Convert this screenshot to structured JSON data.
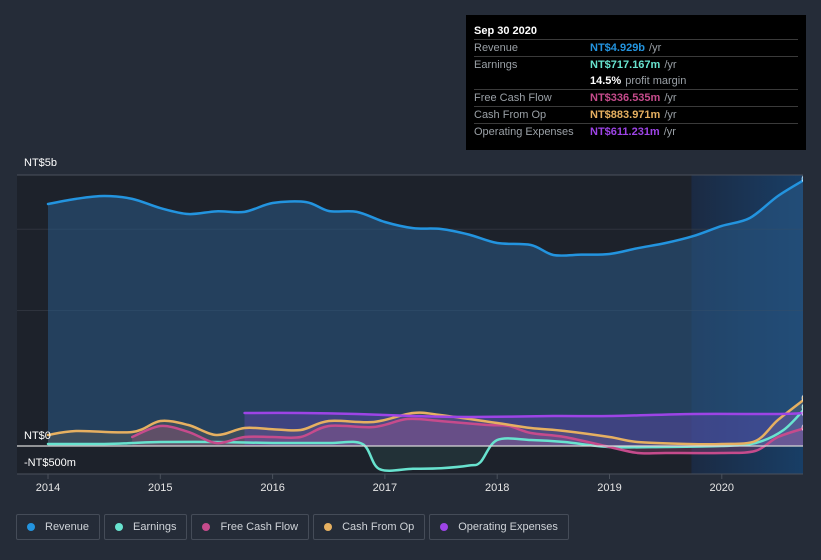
{
  "tooltip": {
    "date": "Sep 30 2020",
    "rows": [
      {
        "label": "Revenue",
        "value": "NT$4.929b",
        "unit": "/yr",
        "color": "#2394df"
      },
      {
        "label": "Earnings",
        "value": "NT$717.167m",
        "unit": "/yr",
        "color": "#68e3cf"
      },
      {
        "label": "",
        "margin_value": "14.5%",
        "margin_text": "profit margin"
      },
      {
        "label": "Free Cash Flow",
        "value": "NT$336.535m",
        "unit": "/yr",
        "color": "#c64b8c"
      },
      {
        "label": "Cash From Op",
        "value": "NT$883.971m",
        "unit": "/yr",
        "color": "#e6b061"
      },
      {
        "label": "Operating Expenses",
        "value": "NT$611.231m",
        "unit": "/yr",
        "color": "#9d44e6"
      }
    ]
  },
  "legend": [
    {
      "label": "Revenue",
      "color": "#2394df"
    },
    {
      "label": "Earnings",
      "color": "#68e3cf"
    },
    {
      "label": "Free Cash Flow",
      "color": "#c64b8c"
    },
    {
      "label": "Cash From Op",
      "color": "#e6b061"
    },
    {
      "label": "Operating Expenses",
      "color": "#9d44e6"
    }
  ],
  "chart_data": {
    "type": "line",
    "title": "",
    "xlabel": "",
    "ylabel": "",
    "currency": "NT$",
    "y_unit": "millions",
    "ylim": [
      -500,
      5000
    ],
    "xlim": [
      2013.7,
      2020.75
    ],
    "y_tick_labels": [
      {
        "value": 5000,
        "label": "NT$5b"
      },
      {
        "value": 0,
        "label": "NT$0"
      },
      {
        "value": -500,
        "label": "-NT$500m"
      }
    ],
    "x_tick_labels": [
      "2014",
      "2015",
      "2016",
      "2017",
      "2018",
      "2019",
      "2020"
    ],
    "x_ticks": [
      2014,
      2015,
      2016,
      2017,
      2018,
      2019,
      2020
    ],
    "highlight_from": 2019.73,
    "grid": true,
    "legend_position": "bottom",
    "series": [
      {
        "name": "Revenue",
        "color": "#2394df",
        "fill": true,
        "x": [
          2014,
          2014.25,
          2014.5,
          2014.75,
          2015,
          2015.25,
          2015.5,
          2015.75,
          2016,
          2016.3,
          2016.5,
          2016.75,
          2017,
          2017.25,
          2017.5,
          2017.75,
          2018,
          2018.3,
          2018.5,
          2018.75,
          2019,
          2019.25,
          2019.5,
          2019.75,
          2020,
          2020.25,
          2020.5,
          2020.75
        ],
        "values": [
          4465,
          4560,
          4612,
          4560,
          4390,
          4280,
          4330,
          4320,
          4483,
          4500,
          4336,
          4320,
          4133,
          4020,
          4004,
          3900,
          3745,
          3708,
          3524,
          3530,
          3542,
          3650,
          3745,
          3875,
          4060,
          4207,
          4612,
          4929
        ]
      },
      {
        "name": "Earnings",
        "color": "#68e3cf",
        "fill": true,
        "x": [
          2014,
          2014.5,
          2014.75,
          2015,
          2015.5,
          2016,
          2016.5,
          2016.8,
          2016.95,
          2017.25,
          2017.5,
          2017.75,
          2017.85,
          2018,
          2018.3,
          2018.6,
          2019,
          2019.5,
          2020,
          2020.3,
          2020.55,
          2020.75
        ],
        "values": [
          37,
          37,
          55,
          74,
          74,
          55,
          55,
          37,
          -424,
          -420,
          -410,
          -360,
          -300,
          111,
          111,
          74,
          -18,
          -18,
          0,
          55,
          295,
          717
        ]
      },
      {
        "name": "Free Cash Flow",
        "color": "#c64b8c",
        "fill": true,
        "x": [
          2014.75,
          2015,
          2015.25,
          2015.5,
          2015.75,
          2016,
          2016.25,
          2016.5,
          2016.9,
          2017.2,
          2017.5,
          2017.9,
          2018.1,
          2018.3,
          2018.6,
          2019,
          2019.25,
          2019.5,
          2020,
          2020.3,
          2020.5,
          2020.75
        ],
        "values": [
          166,
          369,
          260,
          55,
          166,
          166,
          166,
          369,
          350,
          498,
          460,
          390,
          370,
          240,
          166,
          -18,
          -129,
          -129,
          -129,
          -90,
          166,
          337
        ]
      },
      {
        "name": "Cash From Op",
        "color": "#e6b061",
        "fill": true,
        "x": [
          2014,
          2014.25,
          2014.75,
          2015,
          2015.25,
          2015.5,
          2015.75,
          2016,
          2016.25,
          2016.5,
          2016.9,
          2017.25,
          2017.5,
          2018,
          2018.3,
          2018.6,
          2019,
          2019.25,
          2019.7,
          2020,
          2020.3,
          2020.5,
          2020.75
        ],
        "values": [
          203,
          277,
          258,
          461,
          387,
          203,
          332,
          310,
          295,
          461,
          443,
          609,
          570,
          424,
          332,
          277,
          166,
          74,
          37,
          37,
          92,
          480,
          884
        ]
      },
      {
        "name": "Operating Expenses",
        "color": "#9d44e6",
        "fill": true,
        "x": [
          2015.75,
          2016.25,
          2016.75,
          2017.25,
          2017.75,
          2018.5,
          2019,
          2019.75,
          2020.5,
          2020.75
        ],
        "values": [
          609,
          609,
          590,
          553,
          535,
          553,
          553,
          590,
          590,
          611
        ]
      }
    ]
  }
}
